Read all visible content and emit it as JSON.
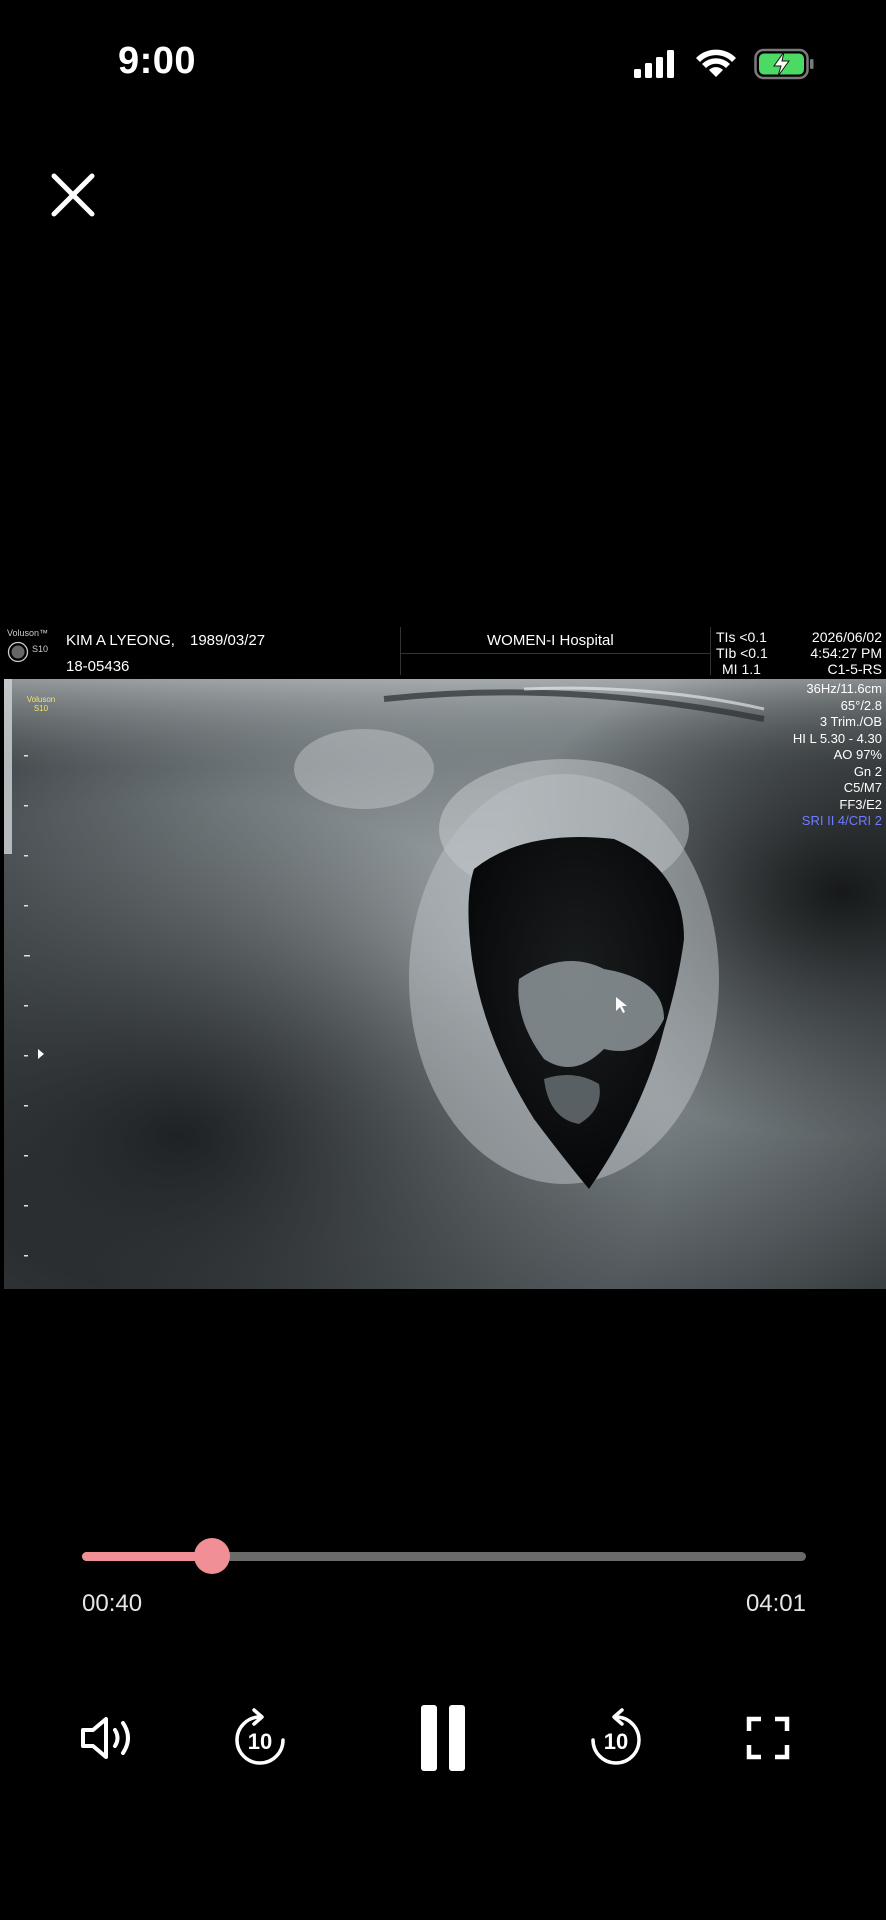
{
  "status_bar": {
    "time": "9:00",
    "icons": [
      "cellular-signal-icon",
      "wifi-icon",
      "battery-charging-icon"
    ]
  },
  "colors": {
    "background": "#000000",
    "accent": "#f18f96",
    "track": "#6a6a6a",
    "battery": "#4cd964",
    "sri_label": "#6f7cff"
  },
  "video": {
    "brand": "Voluson™",
    "model": "S10",
    "probe_logo_text": "Voluson S10",
    "patient_name": "KIM A LYEONG,",
    "birth_date": "1989/03/27",
    "patient_id": "18-05436",
    "hospital": "WOMEN-I Hospital",
    "safety": {
      "tis": "TIs <0.1",
      "tib": "TIb <0.1",
      "mi": "MI  1.1"
    },
    "date": "2026/06/02",
    "clock": "4:54:27 PM",
    "params": [
      "C1-5-RS",
      "36Hz/11.6cm",
      "65°/2.8",
      "3 Trim./OB",
      "HI L  5.30 - 4.30",
      "AO 97%",
      "Gn  2",
      "C5/M7",
      "FF3/E2"
    ],
    "sri": "SRI II 4/CRI 2"
  },
  "player": {
    "current_time": "00:40",
    "duration": "04:01",
    "progress": 0.18,
    "skip_back_seconds": "10",
    "skip_forward_seconds": "10",
    "state": "playing"
  }
}
